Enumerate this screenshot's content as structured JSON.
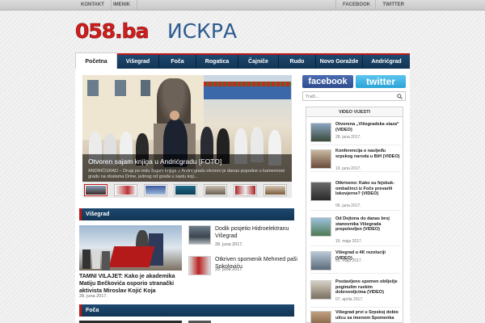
{
  "topbar": {
    "left_links": [
      "KONTAKT",
      "IMENIK"
    ],
    "right_links": [
      "FACEBOOK",
      "TWITTER"
    ]
  },
  "logo": {
    "number": "058.ba",
    "word": "ИСКРА"
  },
  "nav": {
    "items": [
      "Početna",
      "Višegrad",
      "Foča",
      "Rogatica",
      "Čajniče",
      "Rudo",
      "Novo Goražde",
      "Andrićgrad"
    ],
    "active": "Početna"
  },
  "slider": {
    "title": "Otvoren sajam knjiga u Andrićgradu [FOTO]",
    "text": "ANDRIĆGRAD – Drugi po redu Sajam knjiga u Andrićgradu otvoren je danas popodne u kameenom gradu na obalama Drine, jednog od grada u sastu koji..."
  },
  "sections": {
    "visegrad": "Višegrad",
    "foca": "Foča"
  },
  "feature": {
    "title": "TAMNI VILAJET: Kako je akademika Matiju Bečkovića osporio stranački aktivista Miroslav Kojić Koja",
    "date": "28. juna 2017."
  },
  "news": [
    {
      "title": "Dodik posjetio Hidroelektranu Višegrad",
      "date": "28. juna 2017."
    },
    {
      "title": "Otkriven spomenik Mehmed paši Sokoloviću",
      "date": "28. juna 2017."
    }
  ],
  "sidebar": {
    "facebook": "facebook",
    "twitter": "twitter",
    "search_placeholder": "Traži...",
    "video_title": "VIDEO VIJESTI",
    "videos": [
      {
        "title": "Otvorena „Višegradska staza“ (VIDEO)",
        "date": "28. juna 2017."
      },
      {
        "title": "Konferencija o nasljeđu srpskog naroda u BiH (VIDEO)",
        "date": "19. juna 2017."
      },
      {
        "title": "Otkriveno: Kako su fejsbuk-ombačinci iz Foče prevarili lokovjerne? (VIDEO)",
        "date": "06. juna 2017."
      },
      {
        "title": "Od Dejtona do danas broj stanovnika Višegrada prepolovljen (VIDEO)",
        "date": "15. maja 2017."
      },
      {
        "title": "Višegrad u 4K rezoluciji (VIDEO)",
        "date": "05. maja 2017."
      },
      {
        "title": "Postavljeno spomen obilježje poginulim ruskim dobrovoljcima (VIDEO)",
        "date": "07. aprila 2017."
      },
      {
        "title": "Višegrad prvi u Srpskoj dobio ulicu sa imenom Spomenka",
        "date": ""
      }
    ]
  }
}
